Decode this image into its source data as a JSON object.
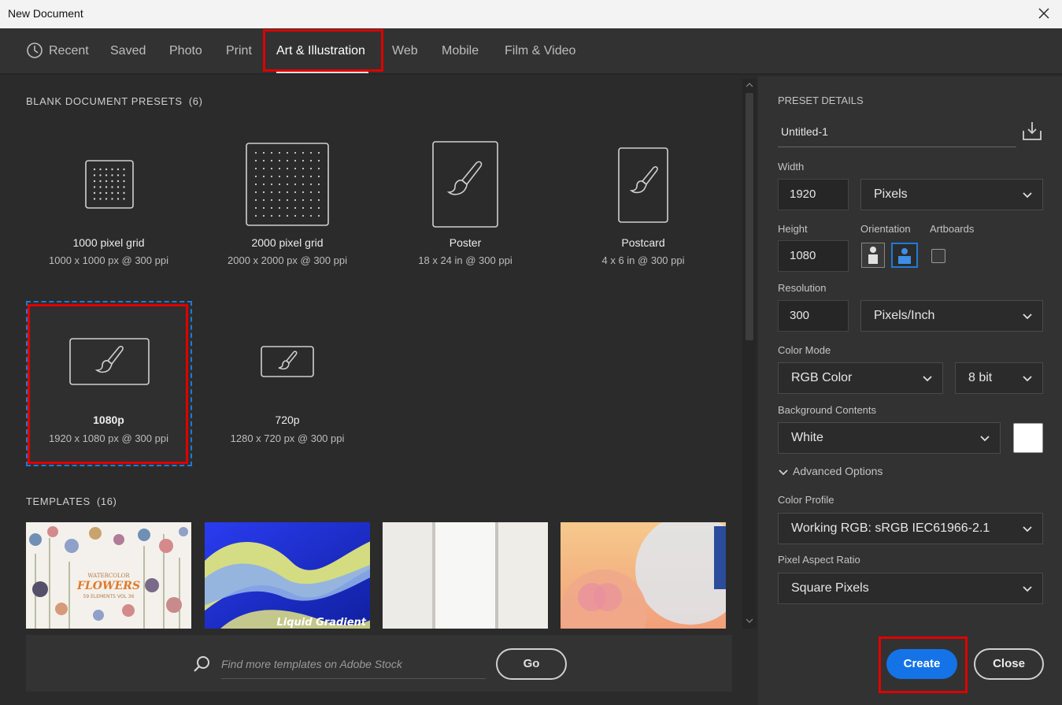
{
  "window": {
    "title": "New Document"
  },
  "tabs": [
    "Recent",
    "Saved",
    "Photo",
    "Print",
    "Art & Illustration",
    "Web",
    "Mobile",
    "Film & Video"
  ],
  "active_tab": "Art & Illustration",
  "presets_section": {
    "title": "BLANK DOCUMENT PRESETS",
    "count": "(6)"
  },
  "presets": [
    {
      "name": "1000 pixel grid",
      "desc": "1000 x 1000 px @ 300 ppi",
      "icon": "grid-icon"
    },
    {
      "name": "2000 pixel grid",
      "desc": "2000 x 2000 px @ 300 ppi",
      "icon": "grid-icon"
    },
    {
      "name": "Poster",
      "desc": "18 x 24 in @ 300 ppi",
      "icon": "brush-portrait-icon"
    },
    {
      "name": "Postcard",
      "desc": "4 x 6 in @ 300 ppi",
      "icon": "brush-portrait-icon"
    },
    {
      "name": "1080p",
      "desc": "1920 x 1080 px @ 300 ppi",
      "icon": "brush-landscape-icon",
      "selected": true
    },
    {
      "name": "720p",
      "desc": "1280 x 720 px @ 300 ppi",
      "icon": "brush-landscape-icon"
    }
  ],
  "templates_section": {
    "title": "TEMPLATES",
    "count": "(16)"
  },
  "templates": [
    {
      "kind": "watercolor-flowers",
      "text_line1": "WATERCOLOR",
      "text_line2": "FLOWERS",
      "text_line3": "59 ELEMENTS VOL 36"
    },
    {
      "kind": "liquid-gradient",
      "text": "Liquid Gradient"
    },
    {
      "kind": "paper-texture"
    },
    {
      "kind": "pastel-gradient"
    }
  ],
  "stock_search": {
    "placeholder": "Find more templates on Adobe Stock",
    "go_label": "Go"
  },
  "details": {
    "section_title": "PRESET DETAILS",
    "doc_name": "Untitled-1",
    "width_label": "Width",
    "width_value": "1920",
    "width_unit": "Pixels",
    "height_label": "Height",
    "height_value": "1080",
    "orientation_label": "Orientation",
    "artboards_label": "Artboards",
    "resolution_label": "Resolution",
    "resolution_value": "300",
    "resolution_unit": "Pixels/Inch",
    "color_mode_label": "Color Mode",
    "color_mode": "RGB Color",
    "bit_depth": "8 bit",
    "bg_label": "Background Contents",
    "bg_value": "White",
    "advanced_label": "Advanced Options",
    "color_profile_label": "Color Profile",
    "color_profile": "Working RGB: sRGB IEC61966-2.1",
    "par_label": "Pixel Aspect Ratio",
    "par_value": "Square Pixels"
  },
  "buttons": {
    "create": "Create",
    "close": "Close"
  },
  "colors": {
    "accent": "#1473e6",
    "highlight": "#e00000",
    "background": "#2b2b2b"
  }
}
